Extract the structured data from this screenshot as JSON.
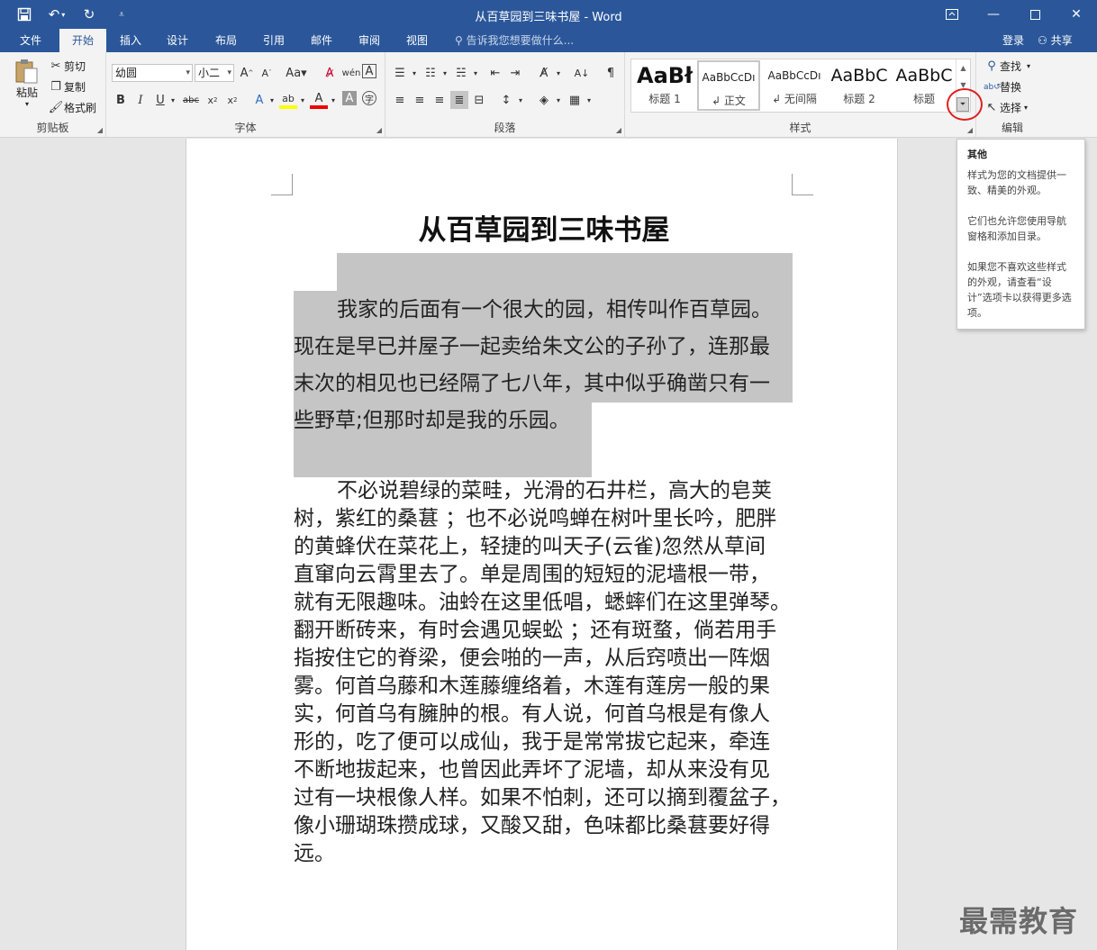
{
  "window": {
    "title": "从百草园到三味书屋 - Word",
    "qat": {
      "save_icon": "save-icon",
      "undo_icon": "undo-icon",
      "redo_icon": "redo-icon",
      "customize_icon": "customize-qat-icon"
    },
    "controls": {
      "restore_ribbon": "ribbon-display-icon",
      "minimize": "minimize-icon",
      "maximize": "maximize-icon",
      "close": "close-icon"
    }
  },
  "tabs": {
    "items": [
      "文件",
      "开始",
      "插入",
      "设计",
      "布局",
      "引用",
      "邮件",
      "审阅",
      "视图"
    ],
    "active": "开始",
    "tell_me": "告诉我您想要做什么...",
    "login": "登录",
    "share": "共享"
  },
  "ribbon": {
    "clipboard": {
      "label": "剪贴板",
      "paste": "粘贴",
      "cut": "剪切",
      "copy": "复制",
      "format_painter": "格式刷"
    },
    "font": {
      "label": "字体",
      "font_name": "幼圆",
      "font_size": "小二"
    },
    "paragraph": {
      "label": "段落"
    },
    "styles": {
      "label": "样式",
      "items": [
        {
          "preview": "AaBł",
          "name": "标题 1"
        },
        {
          "preview": "AaBbCcDı",
          "name": "↲ 正文"
        },
        {
          "preview": "AaBbCcDı",
          "name": "↲ 无间隔"
        },
        {
          "preview": "AaBbC",
          "name": "标题 2"
        },
        {
          "preview": "AaBbC",
          "name": "标题"
        }
      ],
      "selected_index": 1
    },
    "editing": {
      "label": "编辑",
      "find": "查找",
      "replace": "替换",
      "select": "选择"
    }
  },
  "tooltip": {
    "title": "其他",
    "lines": [
      "样式为您的文档提供一致、精美的外观。",
      "它们也允许您使用导航窗格和添加目录。",
      "如果您不喜欢这些样式的外观，请查看“设计”选项卡以获得更多选项。"
    ]
  },
  "document": {
    "title": "从百草园到三味书屋",
    "para1": [
      "我家的后面有一个很大的园，相传叫作百草园。",
      "现在是早已并屋子一起卖给朱文公的子孙了，连那最",
      "末次的相见也已经隔了七八年，其中似乎确凿只有一",
      "些野草;但那时却是我的乐园。"
    ],
    "para2": [
      "不必说碧绿的菜畦，光滑的石井栏，高大的皂荚",
      "树，紫红的桑葚 ；也不必说鸣蝉在树叶里长吟，肥胖",
      "的黄蜂伏在菜花上，轻捷的叫天子(云雀)忽然从草间",
      "直窜向云霄里去了。单是周围的短短的泥墙根一带，",
      "就有无限趣味。油蛉在这里低唱，蟋蟀们在这里弹琴。",
      "翻开断砖来，有时会遇见蜈蚣 ；还有斑蝥，倘若用手",
      "指按住它的脊梁，便会啪的一声，从后窍喷出一阵烟",
      "雾。何首乌藤和木莲藤缠络着，木莲有莲房一般的果",
      "实，何首乌有臃肿的根。有人说，何首乌根是有像人",
      "形的，吃了便可以成仙，我于是常常拔它起来，牵连",
      "不断地拔起来，也曾因此弄坏了泥墙，却从来没有见",
      "过有一块根像人样。如果不怕刺，还可以摘到覆盆子，",
      "像小珊瑚珠攒成球，又酸又甜，色味都比桑葚要好得",
      "远。"
    ]
  },
  "watermark": "最需教育",
  "colors": {
    "accent": "#2b579a",
    "highlight": "#c5c5c5",
    "annotation": "#e02020"
  }
}
